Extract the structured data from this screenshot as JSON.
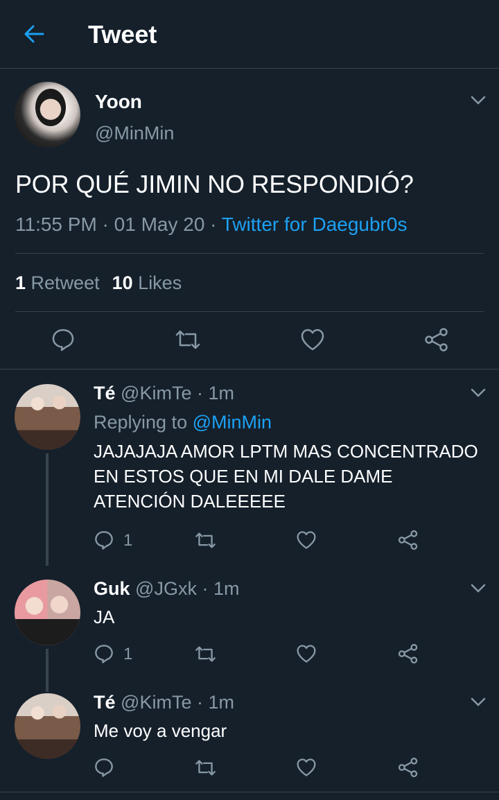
{
  "header": {
    "title": "Tweet"
  },
  "main_tweet": {
    "name": "Yoon",
    "handle": "@MinMin",
    "text": "POR QUÉ JIMIN NO RESPONDIÓ?",
    "time": "11:55 PM · 01 May 20 · ",
    "source": "Twitter for Daegubr0s",
    "retweets_count": "1",
    "retweets_label": "Retweet",
    "likes_count": "10",
    "likes_label": "Likes"
  },
  "replies": [
    {
      "name": "Té",
      "handle": "@KimTe",
      "time": "· 1m",
      "replying_prefix": "Replying to ",
      "replying_to": "@MinMin",
      "text": "JAJAJAJA AMOR LPTM MAS CONCENTRADO EN ESTOS QUE EN MI DALE DAME ATENCIÓN DALEEEEE",
      "reply_count": "1"
    },
    {
      "name": "Guk",
      "handle": "@JGxk",
      "time": "· 1m",
      "text": "JA",
      "reply_count": "1"
    },
    {
      "name": "Té",
      "handle": "@KimTe",
      "time": "· 1m",
      "text": "Me voy a vengar",
      "reply_count": ""
    }
  ],
  "colors": {
    "background": "#15202b",
    "accent": "#1da1f2",
    "secondary_text": "#8899a6",
    "divider": "#38444d"
  },
  "icons": [
    "back-arrow-icon",
    "chevron-down-icon",
    "reply-icon",
    "retweet-icon",
    "like-icon",
    "share-icon"
  ]
}
